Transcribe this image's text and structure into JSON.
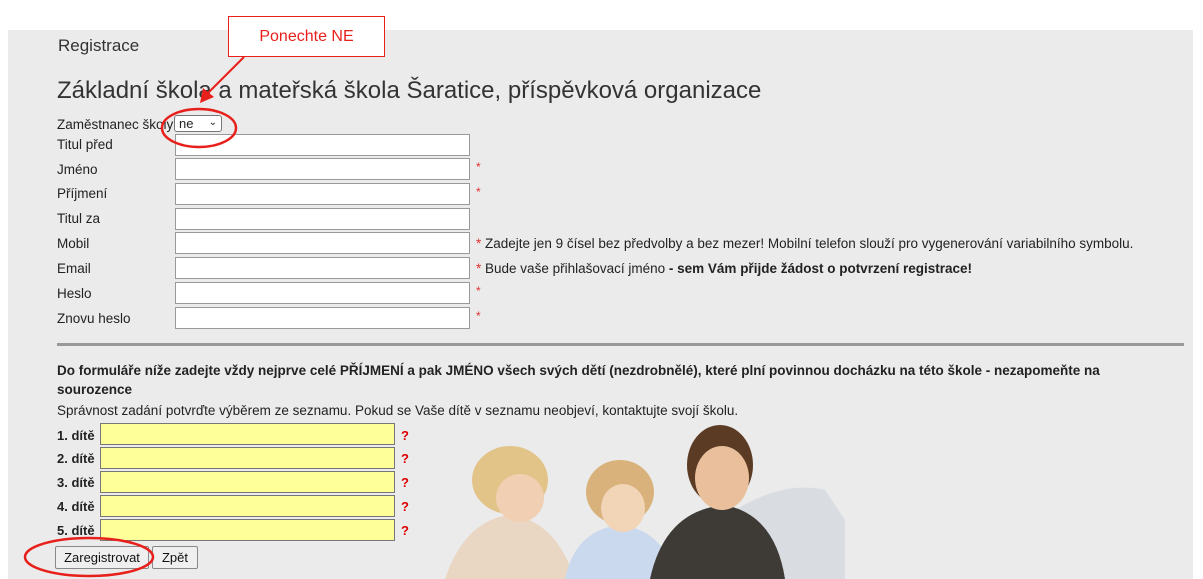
{
  "heading": "Registrace",
  "school_name": "Základní škola a mateřská škola Šaratice, příspěvková organizace",
  "annotation": {
    "callout": "Ponechte NE",
    "color": "#e8201c"
  },
  "employee": {
    "label": "Zaměstnanec školy",
    "value": "ne"
  },
  "fields": {
    "titul_pred": {
      "label": "Titul před",
      "value": ""
    },
    "jmeno": {
      "label": "Jméno",
      "value": "",
      "required": "*"
    },
    "prijmeni": {
      "label": "Příjmení",
      "value": "",
      "required": "*"
    },
    "titul_za": {
      "label": "Titul za",
      "value": ""
    },
    "mobil": {
      "label": "Mobil",
      "value": "",
      "required": "*",
      "note": "Zadejte jen 9 čísel bez předvolby a bez mezer! Mobilní telefon slouží pro vygenerování variabilního symbolu."
    },
    "email": {
      "label": "Email",
      "value": "",
      "required": "*",
      "note": "Bude vaše přihlašovací jméno",
      "note_bold": "- sem Vám přijde žádost o potvrzení registrace!"
    },
    "heslo": {
      "label": "Heslo",
      "value": "",
      "required": "*"
    },
    "znovu_heslo": {
      "label": "Znovu heslo",
      "value": "",
      "required": "*"
    }
  },
  "children_section": {
    "instruction": "Do formuláře níže zadejte vždy nejprve celé PŘÍJMENÍ a pak JMÉNO všech svých dětí (nezdrobnělé), které plní povinnou docházku na této škole - nezapomeňte na sourozence",
    "subtext": "Správnost zadání potvrďte výběrem ze seznamu. Pokud se Vaše dítě v seznamu neobjeví, kontaktujte svojí školu.",
    "help_mark": "?",
    "children": [
      {
        "label": "1. dítě",
        "value": ""
      },
      {
        "label": "2. dítě",
        "value": ""
      },
      {
        "label": "3. dítě",
        "value": ""
      },
      {
        "label": "4. dítě",
        "value": ""
      },
      {
        "label": "5. dítě",
        "value": ""
      }
    ]
  },
  "buttons": {
    "register": "Zaregistrovat",
    "back": "Zpět"
  },
  "colors": {
    "panel": "#ebebeb",
    "child_input": "#ffff99",
    "required": "#e03030"
  }
}
